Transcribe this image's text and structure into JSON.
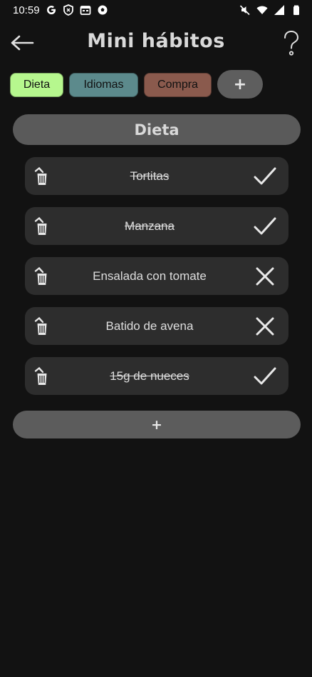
{
  "status_bar": {
    "time": "10:59",
    "left_icons": [
      "google-icon",
      "shield-icon",
      "calendar-icon",
      "soccer-ball-icon"
    ],
    "right_icons": [
      "mute-icon",
      "wifi-icon",
      "signal-icon",
      "battery-icon"
    ]
  },
  "app_bar": {
    "title": "Mini hábitos",
    "back_icon": "arrow-left-icon",
    "help_icon": "question-mark-icon"
  },
  "tabs": [
    {
      "label": "Dieta",
      "color": "#b6f78e",
      "selected": true
    },
    {
      "label": "Idiomas",
      "color": "#5c8a8c",
      "selected": false
    },
    {
      "label": "Compra",
      "color": "#8a5a4d",
      "selected": false
    }
  ],
  "add_tab_label": "+",
  "section": {
    "title": "Dieta"
  },
  "habits": [
    {
      "label": "Tortitas",
      "done": true
    },
    {
      "label": "Manzana",
      "done": true
    },
    {
      "label": "Ensalada con tomate",
      "done": false
    },
    {
      "label": "Batido de avena",
      "done": false
    },
    {
      "label": "15g de nueces",
      "done": true
    }
  ],
  "add_habit_label": "+",
  "colors": {
    "background": "#121212",
    "card": "#2d2d2d",
    "pill": "#5a5a5a",
    "text": "#dedede"
  }
}
